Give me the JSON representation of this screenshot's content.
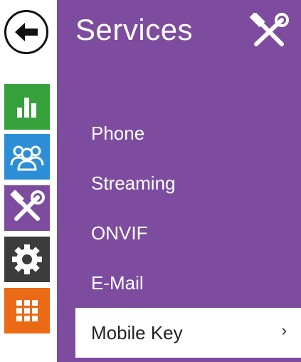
{
  "colors": {
    "panel": "#7d4c9e",
    "nav_status": "#36a13a",
    "nav_users": "#2c8ed6",
    "nav_services": "#7d4c9e",
    "nav_settings": "#3c3c3c",
    "nav_apps": "#eb6a16"
  },
  "nav": {
    "back_icon": "arrow-left-icon",
    "items": [
      {
        "name": "status",
        "icon": "bar-chart-icon"
      },
      {
        "name": "users",
        "icon": "users-icon"
      },
      {
        "name": "services",
        "icon": "tools-icon"
      },
      {
        "name": "settings",
        "icon": "gear-icon"
      },
      {
        "name": "apps",
        "icon": "grid-icon"
      }
    ]
  },
  "panel": {
    "title": "Services",
    "icon": "tools-icon"
  },
  "menu": {
    "items": [
      {
        "label": "Phone"
      },
      {
        "label": "Streaming"
      },
      {
        "label": "ONVIF"
      },
      {
        "label": "E-Mail"
      },
      {
        "label": "Mobile Key",
        "active": true
      }
    ],
    "chevron": "›"
  }
}
